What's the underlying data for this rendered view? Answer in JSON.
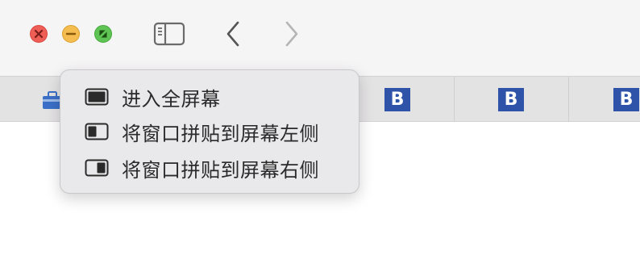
{
  "window": {
    "traffic_lights": [
      {
        "name": "close",
        "color": "#ee5d56"
      },
      {
        "name": "minimize",
        "color": "#f5bd4f"
      },
      {
        "name": "zoom",
        "color": "#5ec453"
      }
    ]
  },
  "toolbar": {
    "sidebar_icon": "sidebar-icon",
    "back_icon": "chevron-left-icon",
    "forward_icon": "chevron-right-icon"
  },
  "tabs": [
    {
      "icon_text": "B"
    },
    {
      "icon_text": "B"
    },
    {
      "icon_text": "B"
    }
  ],
  "popup_menu": {
    "items": [
      {
        "label": "进入全屏幕",
        "icon": "fullscreen-icon"
      },
      {
        "label": "将窗口拼贴到屏幕左侧",
        "icon": "tile-left-icon"
      },
      {
        "label": "将窗口拼贴到屏幕右侧",
        "icon": "tile-right-icon"
      }
    ]
  }
}
